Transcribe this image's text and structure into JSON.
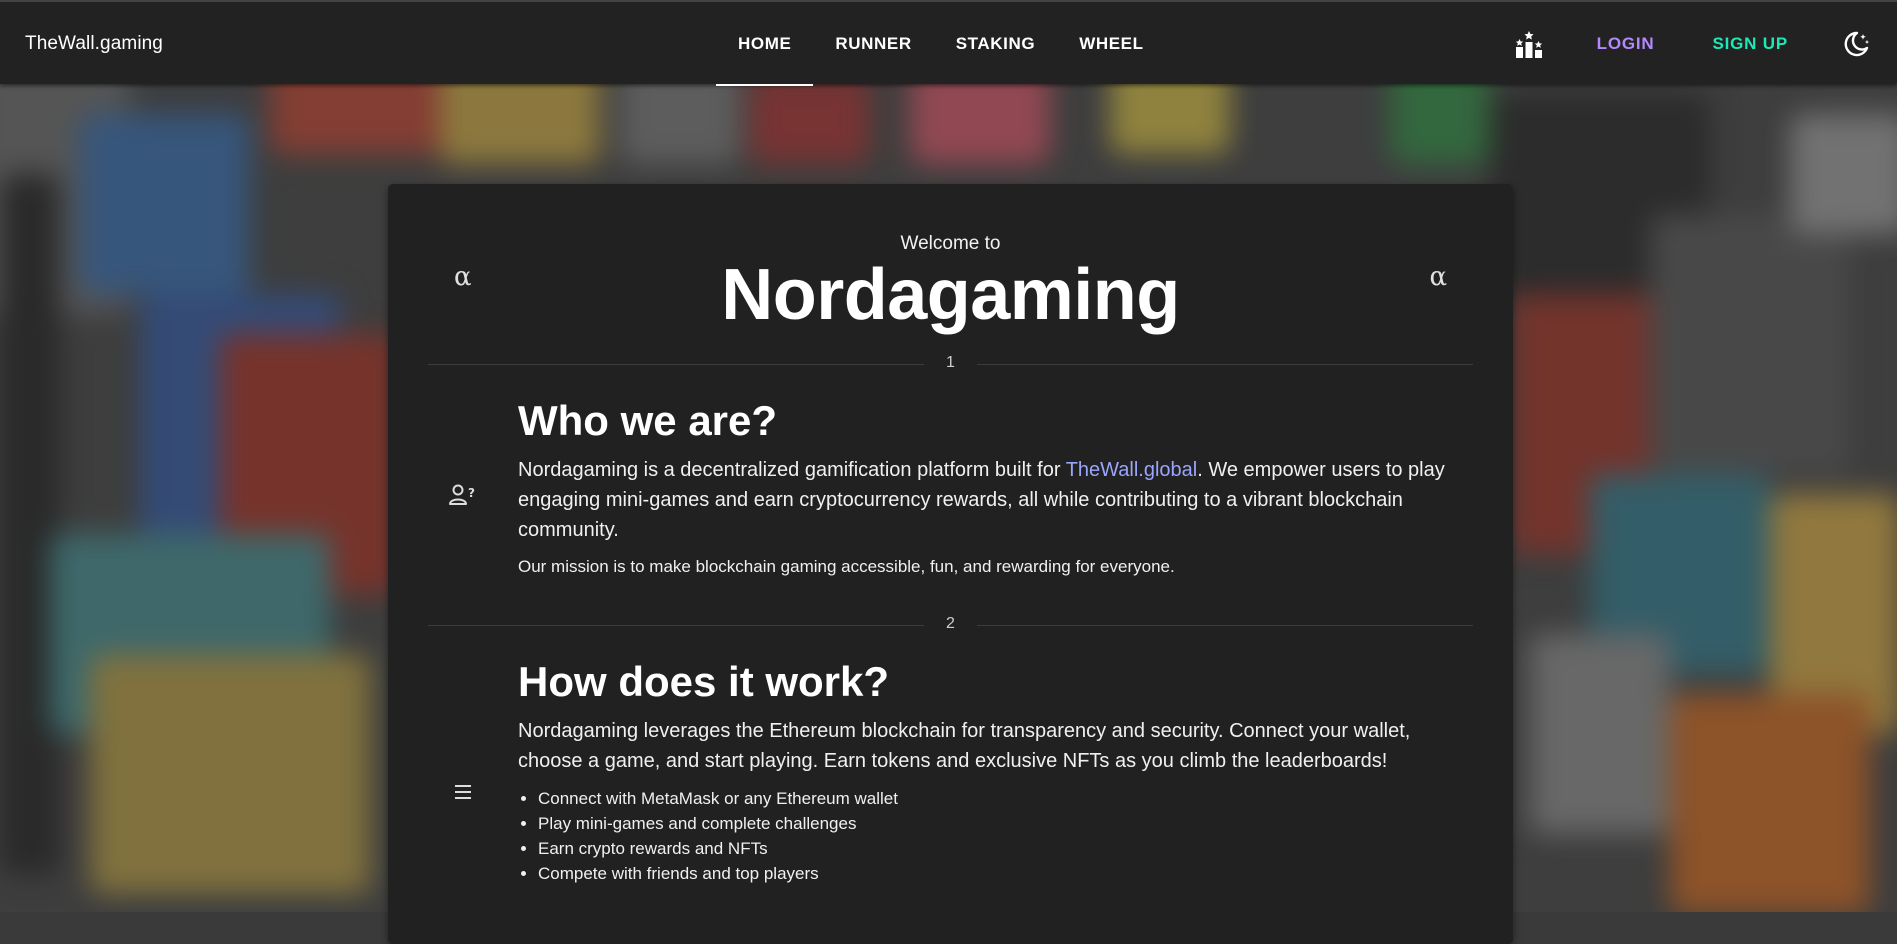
{
  "header": {
    "brand": "TheWall.gaming",
    "nav": [
      "HOME",
      "RUNNER",
      "STAKING",
      "WHEEL"
    ],
    "active_nav": "HOME",
    "login_label": "LOGIN",
    "signup_label": "SIGN UP",
    "icons": [
      "leaderboard-icon",
      "theme-toggle-icon"
    ]
  },
  "colors": {
    "login": "#b388ff",
    "signup": "#1de9b6",
    "link": "#9aa5ff",
    "card_bg": "#212121",
    "bar_bg": "#222222"
  },
  "hero": {
    "welcome": "Welcome to",
    "title": "Nordagaming",
    "badge_left": "α",
    "badge_right": "α"
  },
  "sections": [
    {
      "number": "1",
      "icon": "user-question-icon",
      "heading": "Who we are?",
      "lead_before": "Nordagaming is a decentralized gamification platform built for ",
      "lead_link": "TheWall.global",
      "lead_after": ". We empower users to play engaging mini-games and earn cryptocurrency rewards, all while contributing to a vibrant blockchain community.",
      "note": "Our mission is to make blockchain gaming accessible, fun, and rewarding for everyone."
    },
    {
      "number": "2",
      "icon": "menu-icon",
      "heading": "How does it work?",
      "lead": "Nordagaming leverages the Ethereum blockchain for transparency and security. Connect your wallet, choose a game, and start playing. Earn tokens and exclusive NFTs as you climb the leaderboards!",
      "items": [
        "Connect with MetaMask or any Ethereum wallet",
        "Play mini-games and complete challenges",
        "Earn crypto rewards and NFTs",
        "Compete with friends and top players"
      ]
    }
  ]
}
